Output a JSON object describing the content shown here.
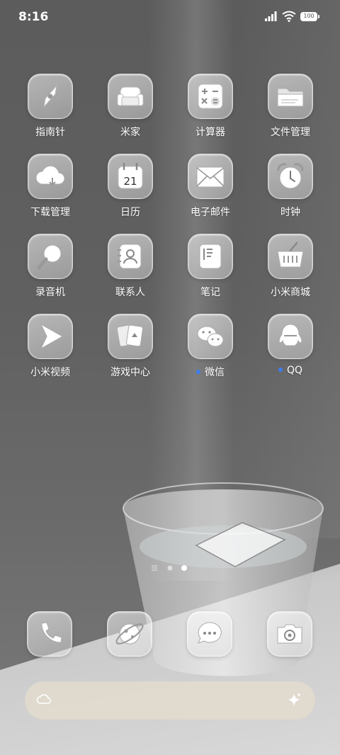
{
  "status_bar": {
    "time": "8:16",
    "battery": "100"
  },
  "apps": [
    {
      "label": "指南针",
      "icon": "compass-icon"
    },
    {
      "label": "米家",
      "icon": "sofa-icon"
    },
    {
      "label": "计算器",
      "icon": "calculator-icon"
    },
    {
      "label": "文件管理",
      "icon": "folder-icon"
    },
    {
      "label": "下载管理",
      "icon": "cloud-download-icon"
    },
    {
      "label": "日历",
      "icon": "calendar-icon",
      "date": "21"
    },
    {
      "label": "电子邮件",
      "icon": "mail-icon"
    },
    {
      "label": "时钟",
      "icon": "clock-icon"
    },
    {
      "label": "录音机",
      "icon": "recorder-icon"
    },
    {
      "label": "联系人",
      "icon": "contacts-icon"
    },
    {
      "label": "笔记",
      "icon": "notes-icon"
    },
    {
      "label": "小米商城",
      "icon": "shopping-basket-icon"
    },
    {
      "label": "小米视频",
      "icon": "play-icon"
    },
    {
      "label": "游戏中心",
      "icon": "cards-icon"
    },
    {
      "label": "微信",
      "icon": "wechat-icon",
      "badge": true
    },
    {
      "label": "QQ",
      "icon": "qq-penguin-icon",
      "badge": true
    }
  ],
  "dock": [
    {
      "icon": "phone-icon"
    },
    {
      "icon": "browser-planet-icon"
    },
    {
      "icon": "message-icon"
    },
    {
      "icon": "camera-icon"
    }
  ],
  "search": {
    "left_icon": "cloud-icon",
    "right_icon": "sparkle-icon"
  },
  "colors": {
    "badge": "#3d7df2",
    "search_bg": "#e1dace"
  }
}
